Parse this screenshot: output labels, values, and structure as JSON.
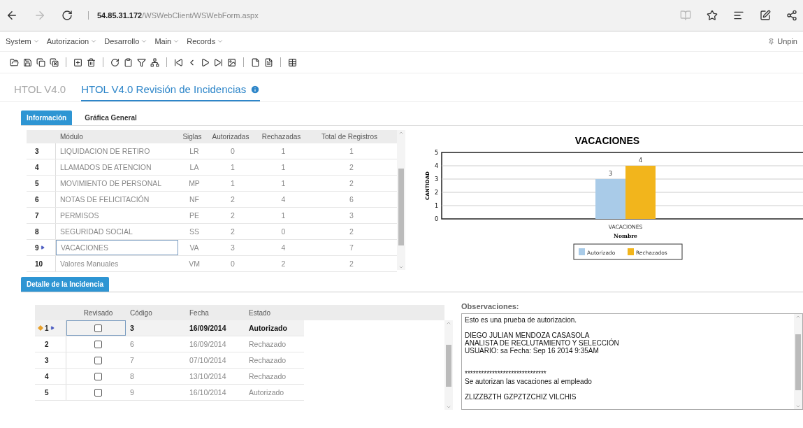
{
  "browser": {
    "url": "**54.85.31.172**/WSWebClient/WSWebForm.aspx"
  },
  "menu": {
    "items": [
      "System",
      "Autorizacion",
      "Desarrollo",
      "Main",
      "Records"
    ],
    "unpin": "Unpin"
  },
  "app_tabs": [
    {
      "label": "HTOL V4.0",
      "selected": false
    },
    {
      "label": "HTOL V4.0 Revisión de Incidencias",
      "selected": true
    }
  ],
  "section_tabs": [
    {
      "label": "Información",
      "selected": true
    },
    {
      "label": "Gráfica General",
      "selected": false
    }
  ],
  "modules_table": {
    "columns": [
      "Módulo",
      "Siglas",
      "Autorizadas",
      "Rechazadas",
      "Total de Registros"
    ],
    "rows": [
      {
        "number": "3",
        "cells": [
          "LIQUIDACION DE RETIRO",
          "LR",
          "0",
          "1",
          "1"
        ],
        "selected": false
      },
      {
        "number": "4",
        "cells": [
          "LLAMADOS DE ATENCION",
          "LA",
          "1",
          "1",
          "2"
        ],
        "selected": false
      },
      {
        "number": "5",
        "cells": [
          "MOVIMIENTO DE PERSONAL",
          "MP",
          "1",
          "1",
          "2"
        ],
        "selected": false
      },
      {
        "number": "6",
        "cells": [
          "NOTAS DE FELICITACIÓN",
          "NF",
          "2",
          "4",
          "6"
        ],
        "selected": false
      },
      {
        "number": "7",
        "cells": [
          "PERMISOS",
          "PE",
          "2",
          "1",
          "3"
        ],
        "selected": false
      },
      {
        "number": "8",
        "cells": [
          "SEGURIDAD SOCIAL",
          "SS",
          "2",
          "0",
          "2"
        ],
        "selected": false
      },
      {
        "number": "9",
        "cells": [
          "VACACIONES",
          "VA",
          "3",
          "4",
          "7"
        ],
        "selected": true
      },
      {
        "number": "10",
        "cells": [
          "Valores Manuales",
          "VM",
          "0",
          "2",
          "2"
        ],
        "selected": false
      }
    ]
  },
  "chart": {
    "chart_data": {
      "type": "bar",
      "title": "VACACIONES",
      "xlabel": "Nombre",
      "ylabel": "CANTIDAD",
      "categories": [
        "VACACIONES"
      ],
      "series": [
        {
          "name": "Autorizado",
          "color": "#a9cbe8",
          "values": [
            3
          ]
        },
        {
          "name": "Rechazados",
          "color": "#f2b51c",
          "values": [
            4
          ]
        }
      ],
      "ylim": [
        0,
        5
      ],
      "yticks": [
        0,
        1,
        2,
        3,
        4,
        5
      ],
      "data_labels": true,
      "grid": true,
      "legend": true
    }
  },
  "detail_tab": {
    "label": "Detalle de la Incidencia",
    "selected": true
  },
  "detail_table": {
    "columns": [
      "Revisado",
      "Código",
      "Fecha",
      "Estado"
    ],
    "rows": [
      {
        "number": "1",
        "edited": true,
        "selected": true,
        "cells": [
          {
            "kind": "checkbox",
            "checked": false
          },
          {
            "kind": "text",
            "text": "3"
          },
          {
            "kind": "text",
            "text": "16/09/2014"
          },
          {
            "kind": "text",
            "text": "Autorizado"
          }
        ]
      },
      {
        "number": "2",
        "edited": false,
        "selected": false,
        "cells": [
          {
            "kind": "checkbox",
            "checked": false
          },
          {
            "kind": "text",
            "text": "6"
          },
          {
            "kind": "text",
            "text": "16/09/2014"
          },
          {
            "kind": "text",
            "text": "Rechazado"
          }
        ]
      },
      {
        "number": "3",
        "edited": false,
        "selected": false,
        "cells": [
          {
            "kind": "checkbox",
            "checked": false
          },
          {
            "kind": "text",
            "text": "7"
          },
          {
            "kind": "text",
            "text": "07/10/2014"
          },
          {
            "kind": "text",
            "text": "Rechazado"
          }
        ]
      },
      {
        "number": "4",
        "edited": false,
        "selected": false,
        "cells": [
          {
            "kind": "checkbox",
            "checked": false
          },
          {
            "kind": "text",
            "text": "8"
          },
          {
            "kind": "text",
            "text": "13/10/2014"
          },
          {
            "kind": "text",
            "text": "Rechazado"
          }
        ]
      },
      {
        "number": "5",
        "edited": false,
        "selected": false,
        "cells": [
          {
            "kind": "checkbox",
            "checked": false
          },
          {
            "kind": "text",
            "text": "9"
          },
          {
            "kind": "text",
            "text": "16/10/2014"
          },
          {
            "kind": "text",
            "text": "Autorizado"
          }
        ]
      }
    ]
  },
  "observations": {
    "label": "Observaciones:",
    "paragraphs": [
      {
        "lines": [
          "Esto es una prueba de autorizacion."
        ]
      },
      {
        "lines": [
          "DIEGO JULIAN MENDOZA CASASOLA",
          "ANALISTA DE RECLUTAMIENTO Y SELECCIÓN",
          "USUARIO: sa  Fecha: Sep 16 2014  9:35AM"
        ]
      },
      {
        "lines": [
          "******************************",
          "Se autorizan las vacaciones al empleado"
        ]
      },
      {
        "lines": [
          "ZLIZZBZTH GZPZTZCHIZ VILCHIS"
        ]
      }
    ]
  }
}
